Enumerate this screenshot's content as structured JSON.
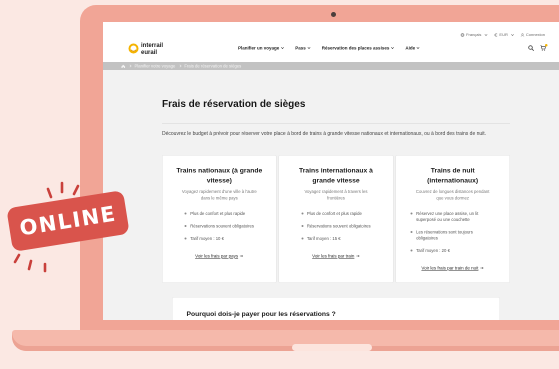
{
  "colors": {
    "background": "#fbe8e3",
    "laptop": "#f1a596",
    "laptop_base": "#f5b9ab",
    "badge": "#d9544c",
    "brand": "#f5b400"
  },
  "badge": {
    "label": "ONLINE"
  },
  "site": {
    "logo": {
      "icon": "logo-icon",
      "line1": "interrail",
      "line2": "eurail"
    },
    "utility": [
      {
        "icon": "globe-icon",
        "label": "Français"
      },
      {
        "icon": "euro-icon",
        "label": "EUR"
      },
      {
        "icon": "user-icon",
        "label": "Connexion"
      }
    ],
    "nav": [
      {
        "label": "Planifier un voyage"
      },
      {
        "label": "Pass"
      },
      {
        "label": "Réservation des places assises"
      },
      {
        "label": "Aide"
      }
    ],
    "header_icons": {
      "search": "search-icon",
      "cart": "cart-icon"
    },
    "breadcrumb": {
      "home_icon": "home-icon",
      "items": [
        "Planifier votre voyage",
        "Frais de réservation de sièges"
      ]
    }
  },
  "page": {
    "title": "Frais de réservation de sièges",
    "intro": "Découvrez le budget à prévoir pour réserver votre place à bord de trains à grande vitesse nationaux et internationaux, ou à bord des trains de nuit.",
    "cards": [
      {
        "title": "Trains nationaux (à grande vitesse)",
        "subtitle": "Voyagez rapidement d'une ville à l'autre dans le même pays",
        "bullets": [
          "Plus de confort et plus rapide",
          "Réservations souvent obligatoires",
          "Tarif moyen : 10 €"
        ],
        "link": "Voir les frais par pays",
        "link_icon": "arrow-right-icon"
      },
      {
        "title": "Trains internationaux à grande vitesse",
        "subtitle": "Voyagez rapidement à travers les frontières",
        "bullets": [
          "Plus de confort et plus rapide",
          "Réservations souvent obligatoires",
          "Tarif moyen : 15 €"
        ],
        "link": "Voir les frais par train",
        "link_icon": "arrow-right-icon"
      },
      {
        "title": "Trains de nuit (internationaux)",
        "subtitle": "Couvrez de longues distances pendant que vous dormez",
        "bullets": [
          "Réservez une place assise, un lit superposé ou une couchette",
          "Les réservations sont toujours obligatoires",
          "Tarif moyen : 20 €"
        ],
        "link": "Voir les frais par train de nuit",
        "link_icon": "arrow-right-icon"
      }
    ],
    "faq": {
      "title": "Pourquoi dois-je payer pour les réservations ?"
    }
  }
}
